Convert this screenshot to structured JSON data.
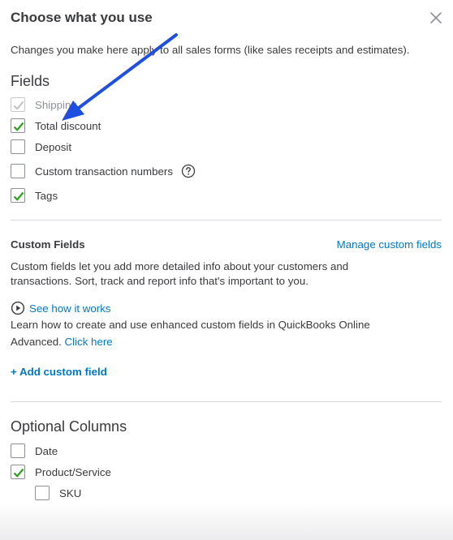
{
  "dialog": {
    "title": "Choose what you use",
    "subtitle": "Changes you make here apply to all sales forms (like sales receipts and estimates).",
    "close_icon": "close-icon"
  },
  "fields": {
    "heading": "Fields",
    "items": [
      {
        "label": "Shipping",
        "checked": true,
        "disabled": true
      },
      {
        "label": "Total discount",
        "checked": true,
        "disabled": false
      },
      {
        "label": "Deposit",
        "checked": false,
        "disabled": false
      },
      {
        "label": "Custom transaction numbers",
        "checked": false,
        "disabled": false,
        "help_icon": "question-circle-icon"
      },
      {
        "label": "Tags",
        "checked": true,
        "disabled": false
      }
    ]
  },
  "custom_fields": {
    "heading": "Custom Fields",
    "manage_link": "Manage custom fields",
    "description_line1": "Custom fields let you add more detailed info about your customers and",
    "description_line2": "transactions. Sort, track and report info that's important to you.",
    "see_how_link": "See how it works",
    "learn_line1": "Learn how to create and use enhanced custom fields in QuickBooks Online",
    "learn_line2": "Advanced.",
    "click_here_link": "Click here",
    "add_link": "+ Add custom field"
  },
  "optional_columns": {
    "heading": "Optional Columns",
    "items": [
      {
        "label": "Date",
        "checked": false
      },
      {
        "label": "Product/Service",
        "checked": true
      },
      {
        "label": "SKU",
        "checked": false
      }
    ]
  },
  "colors": {
    "check_green": "#2ca01c",
    "link_blue": "#0077c5",
    "annotation_arrow": "#1f4fe0"
  }
}
